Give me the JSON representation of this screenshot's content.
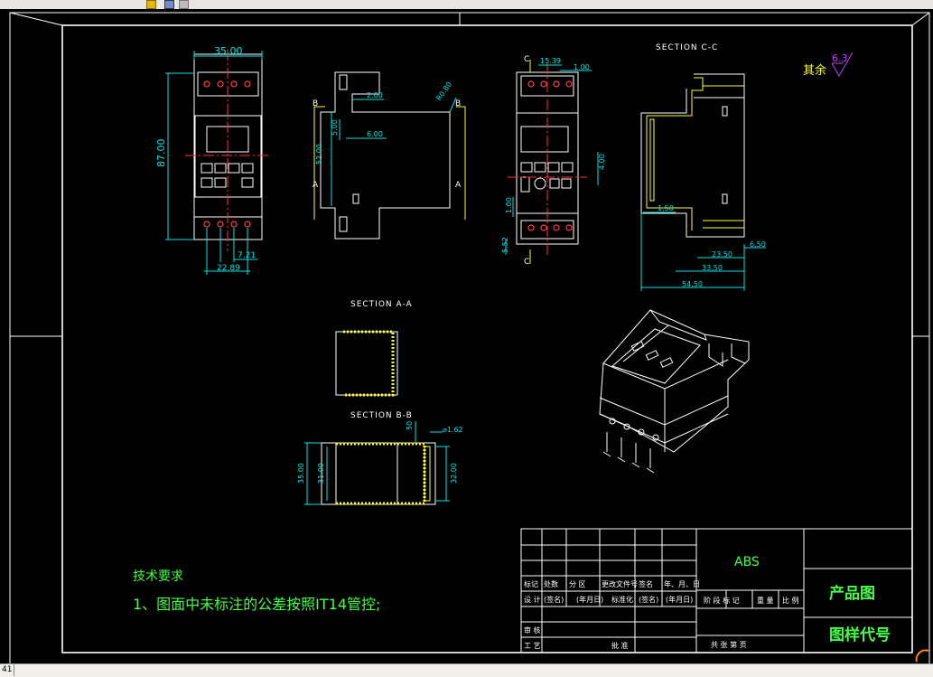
{
  "status": {
    "coordinate_fragment": "41"
  },
  "drawing": {
    "section_aa": "SECTION A-A",
    "section_bb": "SECTION B-B",
    "section_cc": "SECTION C-C",
    "roughness_prefix": "其余",
    "roughness_value": "6.3",
    "labels": {
      "a": "A",
      "b": "B",
      "c": "C"
    },
    "front_view": {
      "width": "35.00",
      "height": "87.00",
      "pitch": "7.21",
      "span": "22.89"
    },
    "side_view": {
      "d1": "2.00",
      "d2": "5.00",
      "d3": "6.00",
      "d4": "52.00",
      "radius": "R0.80"
    },
    "rear_view": {
      "d1": "15.39",
      "d2": "1.00",
      "d3": "4.00",
      "d4": "1.00",
      "d5": "5.52"
    },
    "section_cc_dims": {
      "d1": "1.50",
      "d2": "23.50",
      "d3": "6.50",
      "d4": "33.50",
      "d5": "54.50"
    },
    "section_bb_dims": {
      "d1": "50",
      "d2": "⌀1.62",
      "d3": "35.00",
      "d4": "31.00",
      "d5": "32.00"
    }
  },
  "notes": {
    "heading": "技术要求",
    "item1": "1、图面中未标注的公差按照IT14管控;"
  },
  "title_block": {
    "material": "ABS",
    "product_name": "产品图",
    "drawing_code": "图样代号",
    "row_headers": [
      "标记",
      "处数",
      "分 区",
      "更改文件号",
      "签名",
      "年、月、日"
    ],
    "design_row": [
      "设 计",
      "(签名)",
      "(年月日)",
      "标准化",
      "(签名)",
      "(年月日)"
    ],
    "stage_labels": [
      "阶 段 标 记",
      "重 量",
      "比 例"
    ],
    "review": "审 核",
    "process": "工 艺",
    "approve": "批 准",
    "sheets": "共   张   第   页"
  }
}
